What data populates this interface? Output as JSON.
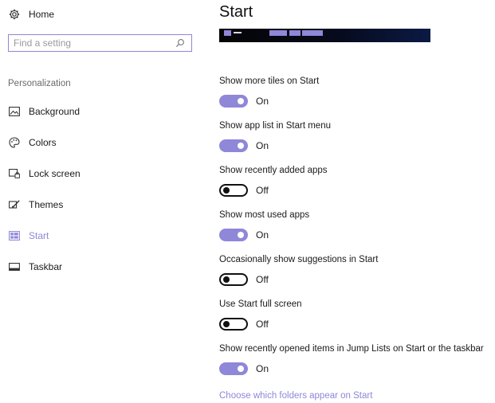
{
  "sidebar": {
    "home_label": "Home",
    "search": {
      "placeholder": "Find a setting",
      "value": ""
    },
    "section_label": "Personalization",
    "items": [
      {
        "label": "Background",
        "icon": "picture-icon"
      },
      {
        "label": "Colors",
        "icon": "palette-icon"
      },
      {
        "label": "Lock screen",
        "icon": "lock-screen-icon"
      },
      {
        "label": "Themes",
        "icon": "brush-icon"
      },
      {
        "label": "Start",
        "icon": "start-tiles-icon",
        "active": true
      },
      {
        "label": "Taskbar",
        "icon": "taskbar-icon"
      }
    ]
  },
  "main": {
    "title": "Start",
    "settings": [
      {
        "title": "Show more tiles on Start",
        "state": "On",
        "on": true
      },
      {
        "title": "Show app list in Start menu",
        "state": "On",
        "on": true
      },
      {
        "title": "Show recently added apps",
        "state": "Off",
        "on": false
      },
      {
        "title": "Show most used apps",
        "state": "On",
        "on": true
      },
      {
        "title": "Occasionally show suggestions in Start",
        "state": "Off",
        "on": false
      },
      {
        "title": "Use Start full screen",
        "state": "Off",
        "on": false
      },
      {
        "title": "Show recently opened items in Jump Lists on Start or the taskbar",
        "state": "On",
        "on": true
      }
    ],
    "link_label": "Choose which folders appear on Start"
  },
  "colors": {
    "accent": "#8f87d8",
    "text": "#1a1a1a",
    "muted": "#6b6b6b"
  }
}
